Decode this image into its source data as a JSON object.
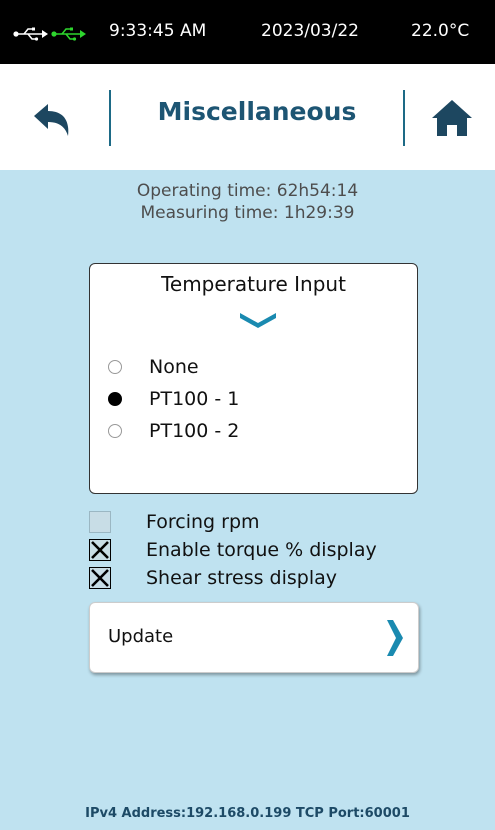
{
  "status_bar": {
    "icons": [
      "usb-icon",
      "usb-connected-icon"
    ],
    "usb_connected_color": "#2ed62e",
    "time": "9:33:45 AM",
    "date": "2023/03/22",
    "temperature": "22.0°C"
  },
  "header": {
    "back_icon": "back-arrow-icon",
    "title": "Miscellaneous",
    "home_icon": "home-icon"
  },
  "times": {
    "operating": "Operating time: 62h54:14",
    "measuring": "Measuring time: 1h29:39"
  },
  "temperature_input": {
    "title": "Temperature Input",
    "expand_icon": "chevron-down-icon",
    "options": [
      {
        "label": "None",
        "selected": false
      },
      {
        "label": "PT100 - 1",
        "selected": true
      },
      {
        "label": "PT100 - 2",
        "selected": false
      }
    ]
  },
  "checkboxes": [
    {
      "label": "Forcing rpm",
      "checked": false
    },
    {
      "label": "Enable torque % display",
      "checked": true
    },
    {
      "label": "Shear stress display",
      "checked": true
    }
  ],
  "update_button": {
    "label": "Update",
    "icon": "chevron-right-icon"
  },
  "footer": {
    "network": "IPv4 Address:192.168.0.199  TCP Port:60001"
  },
  "colors": {
    "background": "#bfe2f0",
    "accent": "#1a8ab0",
    "title": "#1d5573"
  }
}
